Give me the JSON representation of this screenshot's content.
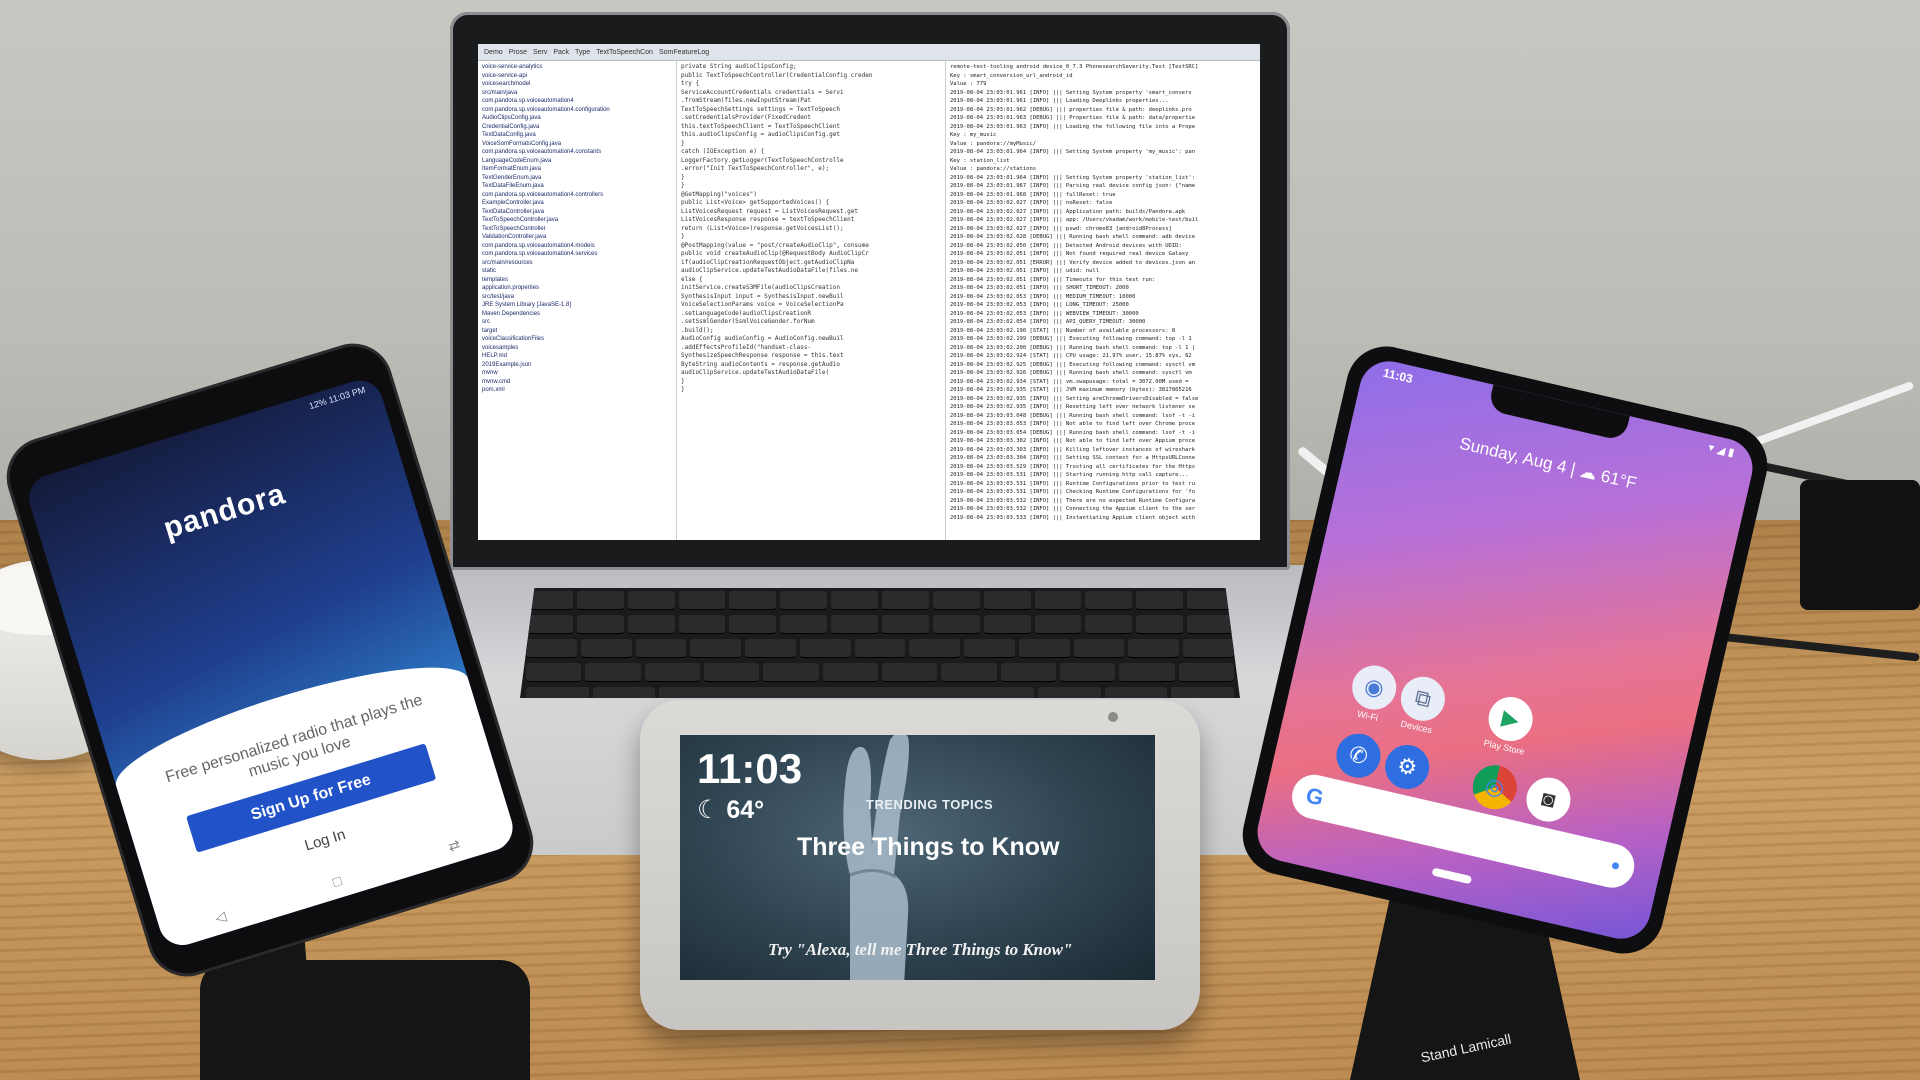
{
  "laptop": {
    "ide_tabs": [
      "Demo",
      "Prose",
      "Serv",
      "Pack",
      "Type",
      "TextToSpeechCon",
      "SomFeatureLog"
    ],
    "package_tree": [
      "voice-service-analytics",
      "voice-service-api",
      "voicesearchmodel",
      "src/main/java",
      "com.pandora.sp.voiceautomation4",
      "com.pandora.sp.voiceautomation4.configuration",
      "AudioClipsConfig.java",
      "CredentialConfig.java",
      "TextDataConfig.java",
      "VoiceSomFormatsConfig.java",
      "com.pandora.sp.voiceautomation4.constants",
      "LanguageCodeEnum.java",
      "ItemFormatEnum.java",
      "TextGenderEnum.java",
      "TextDataFileEnum.java",
      "com.pandora.sp.voiceautomation4.controllers",
      "ExampleController.java",
      "TextDataController.java",
      "TextToSpeechController.java",
      "TextToSpeechController",
      "ValidationController.java",
      "com.pandora.sp.voiceautomation4.models",
      "com.pandora.sp.voiceautomation4.services",
      "src/main/resources",
      "static",
      "templates",
      "application.properties",
      "src/test/java",
      "JRE System Library [JavaSE-1.8]",
      "Maven Dependencies",
      "src",
      "target",
      "voiceClassificationFiles",
      "voicesamples",
      "HELP.md",
      "2019Example.json",
      "mvnw",
      "mvnw.cmd",
      "pom.xml"
    ],
    "code_lines": [
      "private String audioClipsConfig;",
      "",
      "public TextToSpeechController(CredentialConfig creden",
      "  try {",
      "    ServiceAccountCredentials credentials = Servi",
      "        .fromStream(files.newInputStream(Pat",
      "    TextToSpeechSettings settings = TextToSpeech",
      "        .setCredentialsProvider(FixedCredent",
      "    this.textToSpeechClient = TextToSpeechClient",
      "    this.audioClipsConfig = audioClipsConfig.get",
      "  }",
      "  catch (IOException e) {",
      "    LoggerFactory.getLogger(TextToSpeechControlle",
      "      .error(\"Init TextToSpeechController\", e);",
      "  }",
      "}",
      "",
      "@GetMapping(\"voices\")",
      "public List<Voice> getSupportedVoices() {",
      "  ListVoicesRequest request = ListVoicesRequest.get",
      "  ListVoicesResponse response = textToSpeechClient",
      "  return (List<Voice>)response.getVoicesList();",
      "}",
      "",
      "@PostMapping(value = \"post/createAudioClip\", consume",
      "public void createAudioClip(@RequestBody AudioClipCr",
      "",
      "  if(audioClipCreationRequestObject.getAudioClipNa",
      "    audioClipService.updateTestAudioDataFile(files.ne",
      "  else {",
      "    initService.createS3MFile(audioClipsCreation",
      "",
      "  SynthesisInput input = SynthesisInput.newBuil",
      "",
      "  VoiceSelectionParams voice = VoiceSelectionPa",
      "      .setLanguageCode(audioClipsCreationR",
      "      .setSsmlGender(SsmlVoiceGender.forNum",
      "      .build();",
      "",
      "  AudioConfig audioConfig = AudioConfig.newBuil",
      "      .addEffectsProfileId(\"handset-class-",
      "",
      "  SynthesizeSpeechResponse response = this.text",
      "",
      "  ByteString audioContents = response.getAudio",
      "",
      "  audioClipService.updateTestAudioDataFile(",
      "  }",
      "}"
    ],
    "log_lines": [
      "remote-test-tooling android device_0_7.3 PhonesearchSeverity.Test [TestSRC]",
      "Key : smart_conversion_url_android_id",
      "Value : 779",
      "2019-08-04 23:03:01.961 [INFO] ||| Setting System property 'smart_convers",
      "2019-08-04 23:03:01.961 [INFO] ||| Loading Deeplinks properties...",
      "2019-08-04 23:03:01.962 [DEBUG] ||| properties file & path: deeplinks.pro",
      "2019-08-04 23:03:01.963 [DEBUG] ||| Properties file & path: data/propertie",
      "2019-08-04 23:03:01.963 [INFO] ||| Loading the following file into a Prope",
      "Key : my_music",
      "Value : pandora://myMusic/",
      "2019-08-04 23:03:01.964 [INFO] ||| Setting System property 'my_music': pan",
      "Key : station_list",
      "Value : pandora://stations",
      "2019-08-04 23:03:01.964 [INFO] ||| Setting System property 'station_list':",
      "2019-08-04 23:03:01.967 [INFO] ||| Parsing real device config json: {\"name",
      "2019-08-04 23:03:01.968 [INFO] ||| fullReset: true",
      "2019-08-04 23:03:02.027 [INFO] ||| noReset: false",
      "2019-08-04 23:03:02.027 [INFO] ||| Application path: builds/Pandora.apk",
      "2019-08-04 23:03:02.027 [INFO] ||| app: /Users/vkadam/work/mobile-test/buil",
      "2019-08-04 23:03:02.027 [INFO] ||| pswd: chrome83 [android8Process]",
      "2019-08-04 23:03:02.028 [DEBUG] ||| Running bash shell command: adb device",
      "2019-08-04 23:03:02.050 [INFO] ||| Detected Android devices with UDID:",
      "2019-08-04 23:03:02.051 [INFO] ||| Not found required real device Galaxy",
      "2019-08-04 23:03:02.051 [ERROR] ||| Verify device added to devices.json an",
      "2019-08-04 23:03:02.051 [INFO] ||| udid: null",
      "2019-08-04 23:03:02.051 [INFO] ||| Timeouts for this test run:",
      "2019-08-04 23:03:02.051 [INFO] ||| SHORT_TIMEOUT: 2000",
      "2019-08-04 23:03:02.053 [INFO] ||| MEDIUM_TIMEOUT: 10000",
      "2019-08-04 23:03:02.053 [INFO] ||| LONG_TIMEOUT: 25000",
      "2019-08-04 23:03:02.053 [INFO] ||| WEBVIEW_TIMEOUT: 30000",
      "2019-08-04 23:03:02.054 [INFO] ||| API_QUERY_TIMEOUT: 30000",
      "2019-08-04 23:03:02.190 [STAT] ||| Number of available processors: 8",
      "2019-08-04 23:03:02.199 [DEBUG] ||| Executing following command: top -l 1",
      "2019-08-04 23:03:02.200 [DEBUG] ||| Running bash shell command: top -l 1 |",
      "2019-08-04 23:03:02.924 [STAT] ||| CPU usage: 21.97% user, 15.87% sys, 62",
      "2019-08-04 23:03:02.925 [DEBUG] ||| Executing following command: sysctl vm",
      "2019-08-04 23:03:02.926 [DEBUG] ||| Running bash shell command: sysctl vm",
      "2019-08-04 23:03:02.934 [STAT] ||| vm.swapusage: total = 3072.00M used =",
      "2019-08-04 23:03:02.935 [STAT] ||| JVM maximum memory (bytes): 3817865216",
      "2019-08-04 23:03:02.935 [INFO] ||| Setting areChromeDriversDisabled = false",
      "2019-08-04 23:03:02.935 [INFO] ||| Resetting left over network listener se",
      "2019-08-04 23:03:03.048 [DEBUG] ||| Running bash shell command: lsof -t -i",
      "2019-08-04 23:03:03.053 [INFO] ||| Not able to find left over Chrome proce",
      "2019-08-04 23:03:03.054 [DEBUG] ||| Running bash shell command: lsof -t -i",
      "2019-08-04 23:03:03.302 [INFO] ||| Not able to find left over Appium proce",
      "2019-08-04 23:03:03.303 [INFO] ||| Killing leftover instances of wireshark",
      "2019-08-04 23:03:03.304 [INFO] ||| Setting SSL context for a HttpsURLConne",
      "2019-08-04 23:03:03.529 [INFO] ||| Trusting all certificates for the Https",
      "2019-08-04 23:03:03.531 [INFO] ||| Starting running http call capture...",
      "2019-08-04 23:03:03.531 [INFO] ||| Runtime Configurations prior to test ru",
      "2019-08-04 23:03:03.531 [INFO] ||| Checking Runtime Configurations for 'fo",
      "2019-08-04 23:03:03.532 [INFO] ||| There are no expected Runtime Configura",
      "2019-08-04 23:03:03.532 [INFO] ||| Connecting the Appium client to the ser",
      "2019-08-04 23:03:03.533 [INFO] ||| Instantiating Appium client object with"
    ]
  },
  "left_phone": {
    "status": "12% 11:03 PM",
    "logo": "pandora",
    "tagline": "Free personalized radio that plays the music you love",
    "signup_label": "Sign Up for Free",
    "login_label": "Log In",
    "nav": [
      "◁",
      "□",
      "⇄"
    ]
  },
  "echo_show": {
    "time": "11:03",
    "temperature": "64°",
    "section": "TRENDING TOPICS",
    "headline": "Three Things to Know",
    "hint": "Try \"Alexa, tell me Three Things to Know\""
  },
  "right_phone": {
    "time": "11:03",
    "date_weather": "Sunday, Aug 4 | ☁ 61°F",
    "apps": [
      {
        "label": "Wi-Fi",
        "icon": "wifi-icon",
        "glyph": "◉"
      },
      {
        "label": "Devices",
        "icon": "devices-icon",
        "glyph": "⧉"
      },
      {
        "label": "Play Store",
        "icon": "play-store-icon",
        "glyph": "▶"
      }
    ],
    "dock": [
      {
        "icon": "phone-icon",
        "glyph": "✆"
      },
      {
        "icon": "settings-icon",
        "glyph": "⚙"
      },
      {
        "icon": "chrome-icon",
        "glyph": "◎"
      },
      {
        "icon": "camera-icon",
        "glyph": "◙"
      }
    ],
    "search_logo": "G"
  },
  "stand": {
    "brand": "Lamicall",
    "label": "Stand"
  },
  "colors": {
    "pandora_blue": "#2252c8",
    "echo_bg": "#2e4350",
    "pixel_pink": "#e67495"
  }
}
